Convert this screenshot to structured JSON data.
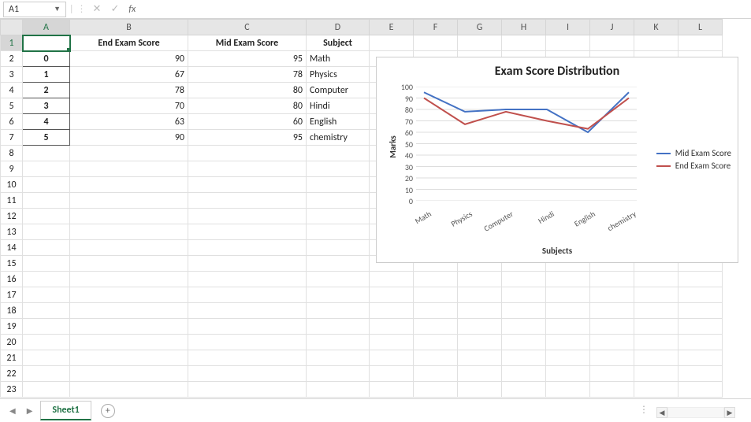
{
  "name_box": "A1",
  "formula_value": "",
  "columns": [
    "A",
    "B",
    "C",
    "D",
    "E",
    "F",
    "G",
    "H",
    "I",
    "J",
    "K",
    "L"
  ],
  "row_count": 23,
  "active_cell": {
    "row": 1,
    "col": "A"
  },
  "table": {
    "headers": {
      "B": "End Exam Score",
      "C": "Mid Exam Score",
      "D": "Subject"
    },
    "rows": [
      {
        "idx": "0",
        "B": "90",
        "C": "95",
        "D": "Math"
      },
      {
        "idx": "1",
        "B": "67",
        "C": "78",
        "D": "Physics"
      },
      {
        "idx": "2",
        "B": "78",
        "C": "80",
        "D": "Computer"
      },
      {
        "idx": "3",
        "B": "70",
        "C": "80",
        "D": "Hindi"
      },
      {
        "idx": "4",
        "B": "63",
        "C": "60",
        "D": "English"
      },
      {
        "idx": "5",
        "B": "90",
        "C": "95",
        "D": "chemistry"
      }
    ]
  },
  "chart_data": {
    "type": "line",
    "title": "Exam Score Distribution",
    "xlabel": "Subjects",
    "ylabel": "Marks",
    "categories": [
      "Math",
      "Physics",
      "Computer",
      "Hindi",
      "English",
      "chemistry"
    ],
    "series": [
      {
        "name": "Mid Exam Score",
        "color": "#4472C4",
        "values": [
          95,
          78,
          80,
          80,
          60,
          95
        ]
      },
      {
        "name": "End Exam Score",
        "color": "#C0504D",
        "values": [
          90,
          67,
          78,
          70,
          63,
          90
        ]
      }
    ],
    "ylim": [
      0,
      100
    ],
    "ystep": 10
  },
  "sheet_tabs": {
    "active": "Sheet1"
  },
  "icons": {
    "cancel": "✕",
    "confirm": "✓",
    "nav_left": "◀",
    "nav_right": "▶",
    "add": "+",
    "dropdown": "▼",
    "ellipsis": "⋮"
  }
}
